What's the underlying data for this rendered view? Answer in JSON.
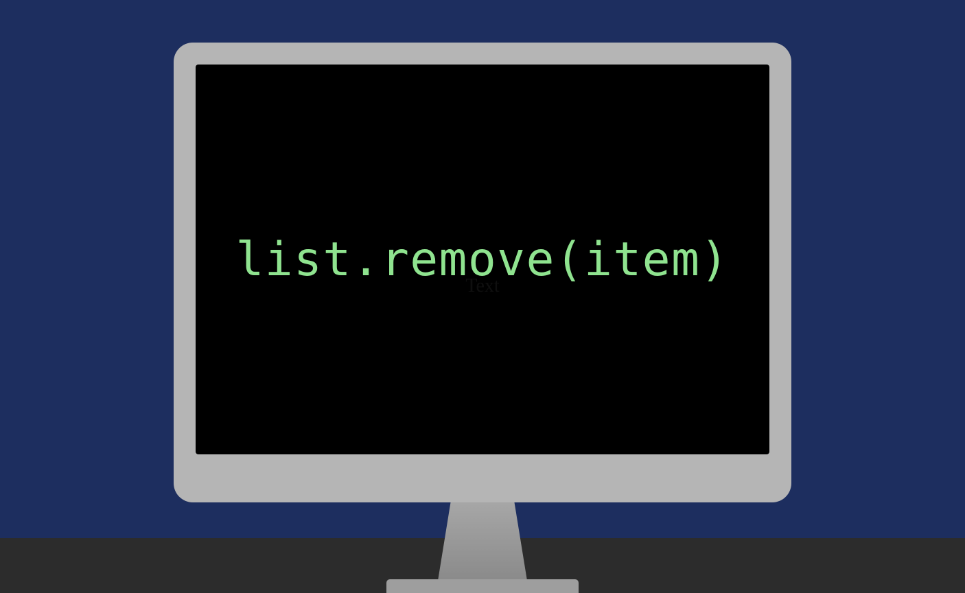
{
  "screen": {
    "code": "list.remove(item)",
    "background_text": "Text"
  }
}
